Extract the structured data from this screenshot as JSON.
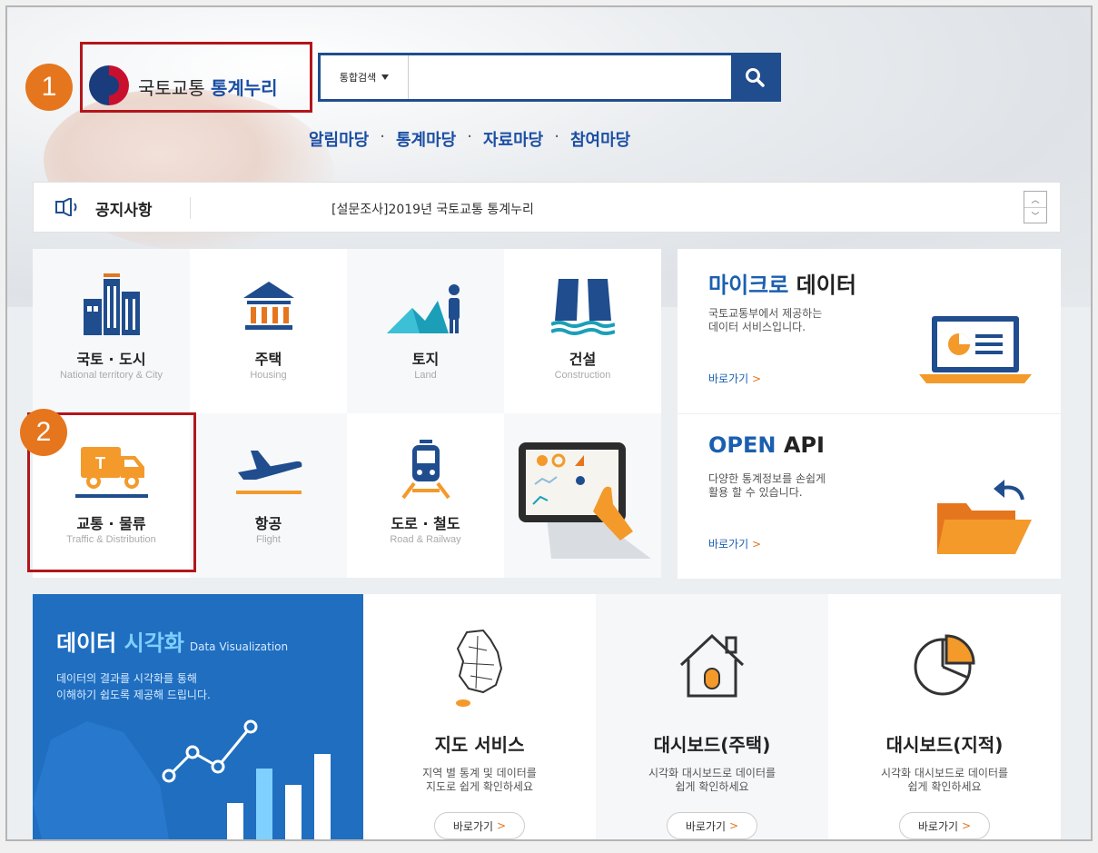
{
  "logo": {
    "prefix": "국토교통",
    "highlight": "통계누리"
  },
  "badges": {
    "one": "1",
    "two": "2"
  },
  "search": {
    "select_label": "통합검색",
    "placeholder": ""
  },
  "gnb": [
    "알림마당",
    "통계마당",
    "자료마당",
    "참여마당"
  ],
  "gnb_sep": "·",
  "notice": {
    "title": "공지사항",
    "message": "[설문조사]2019년 국토교통 통계누리"
  },
  "categories": [
    {
      "ko": "국토 · 도시",
      "en": "National territory & City",
      "icon": "building-icon"
    },
    {
      "ko": "주택",
      "en": "Housing",
      "icon": "house-icon"
    },
    {
      "ko": "토지",
      "en": "Land",
      "icon": "land-icon"
    },
    {
      "ko": "건설",
      "en": "Construction",
      "icon": "construction-icon"
    },
    {
      "ko": "교통 · 물류",
      "en": "Traffic & Distribution",
      "icon": "truck-icon"
    },
    {
      "ko": "항공",
      "en": "Flight",
      "icon": "airplane-icon"
    },
    {
      "ko": "도로 · 철도",
      "en": "Road & Railway",
      "icon": "train-icon"
    },
    {
      "ko": "",
      "en": "",
      "icon": "tablet-chart-icon"
    }
  ],
  "micro": {
    "title_hl": "마이크로",
    "title_rest": " 데이터",
    "desc1": "국토교통부에서 제공하는",
    "desc2": "데이터 서비스입니다.",
    "link": "바로가기",
    "link_arrow": ">"
  },
  "openapi": {
    "title_hl": "OPEN",
    "title_rest": " API",
    "desc1": "다양한 통계정보를 손쉽게",
    "desc2": "활용 할 수 있습니다.",
    "link": "바로가기",
    "link_arrow": ">"
  },
  "viz": {
    "title_plain": "데이터 ",
    "title_hl": "시각화",
    "title_en": "Data Visualization",
    "desc1": "데이터의 결과를 시각화를 통해",
    "desc2": "이해하기 쉽도록 제공해 드립니다."
  },
  "services": [
    {
      "title": "지도 서비스",
      "desc1": "지역 별 통계 및 데이터를",
      "desc2": "지도로 쉽게 확인하세요",
      "btn": "바로가기",
      "arrow": ">",
      "icon": "korea-map-icon"
    },
    {
      "title": "대시보드(주택)",
      "desc1": "시각화 대시보드로 데이터를",
      "desc2": "쉽게 확인하세요",
      "btn": "바로가기",
      "arrow": ">",
      "icon": "house-outline-icon"
    },
    {
      "title": "대시보드(지적)",
      "desc1": "시각화 대시보드로 데이터를",
      "desc2": "쉽게 확인하세요",
      "btn": "바로가기",
      "arrow": ">",
      "icon": "pie-chart-icon"
    }
  ],
  "colors": {
    "brand_blue": "#1f4d8e",
    "accent_orange": "#e5761e",
    "highlight_red": "#b2161c",
    "viz_blue": "#1f6ec0"
  }
}
